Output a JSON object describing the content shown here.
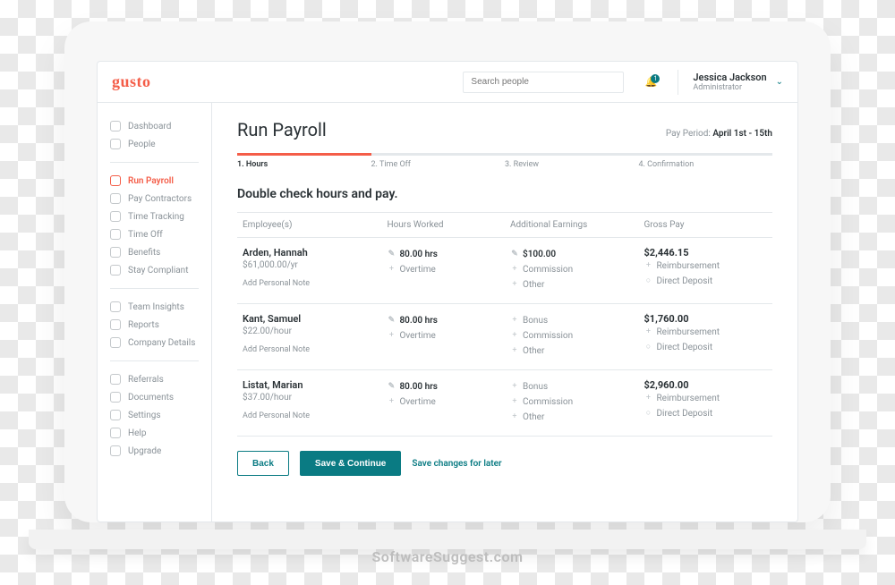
{
  "brand": {
    "logo_text": "gusto"
  },
  "search": {
    "placeholder": "Search people"
  },
  "notifications": {
    "count": "1"
  },
  "user": {
    "name": "Jessica Jackson",
    "role": "Administrator"
  },
  "sidebar": {
    "group1": [
      "Dashboard",
      "People"
    ],
    "group2": [
      "Run Payroll",
      "Pay Contractors",
      "Time Tracking",
      "Time Off",
      "Benefits",
      "Stay Compliant"
    ],
    "group3": [
      "Team Insights",
      "Reports",
      "Company Details"
    ],
    "group4": [
      "Referrals",
      "Documents",
      "Settings",
      "Help",
      "Upgrade"
    ]
  },
  "page": {
    "title": "Run Payroll",
    "pay_period_label": "Pay Period:",
    "pay_period_value": "April 1st - 15th",
    "steps": [
      "1. Hours",
      "2. Time Off",
      "3. Review",
      "4. Confirmation"
    ],
    "subheading": "Double check hours and pay.",
    "columns": [
      "Employee(s)",
      "Hours Worked",
      "Additional Earnings",
      "Gross Pay"
    ],
    "add_note": "Add Personal Note",
    "overtime": "Overtime",
    "commission": "Commission",
    "other": "Other",
    "bonus": "Bonus",
    "reimbursement": "Reimbursement",
    "direct_deposit": "Direct Deposit"
  },
  "rows": [
    {
      "name": "Arden, Hannah",
      "rate": "$61,000.00/yr",
      "hours": "80.00 hrs",
      "addl_top": "$100.00",
      "addl_top_is_amount": true,
      "gross": "$2,446.15"
    },
    {
      "name": "Kant, Samuel",
      "rate": "$22.00/hour",
      "hours": "80.00 hrs",
      "addl_top": "Bonus",
      "addl_top_is_amount": false,
      "gross": "$1,760.00"
    },
    {
      "name": "Listat, Marian",
      "rate": "$37.00/hour",
      "hours": "80.00 hrs",
      "addl_top": "Bonus",
      "addl_top_is_amount": false,
      "gross": "$2,960.00"
    }
  ],
  "actions": {
    "back": "Back",
    "save_continue": "Save & Continue",
    "save_later": "Save changes for later"
  },
  "watermark": "SoftwareSuggest.com"
}
